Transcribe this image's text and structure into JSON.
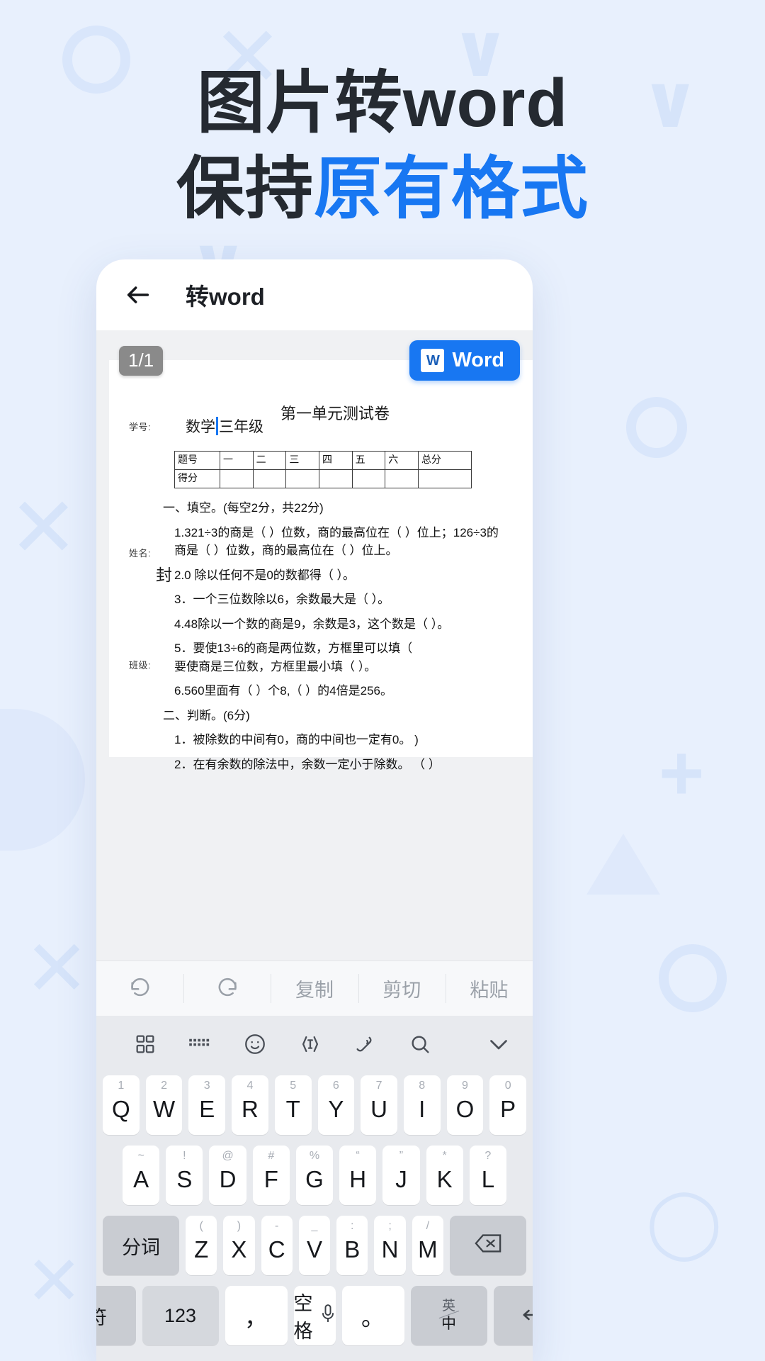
{
  "promo": {
    "headline_line1": "图片转word",
    "headline_line2_dark": "保持",
    "headline_line2_accent": "原有格式",
    "accent_color": "#1877f2",
    "background_color": "#e8f0fd"
  },
  "app": {
    "back_icon": "back-arrow-icon",
    "title": "转word",
    "page_badge": "1/1",
    "export_button": {
      "label": "Word",
      "icon": "word-file-icon",
      "color": "#1877f2"
    }
  },
  "document": {
    "title": "第一单元测试卷",
    "side_labels": [
      "学号:",
      "姓名:",
      "班级:"
    ],
    "seal_char": "封",
    "subject_before_caret": "数学",
    "subject_after_caret": "三年级",
    "score_table": {
      "rows": [
        [
          "题号",
          "一",
          "二",
          "三",
          "四",
          "五",
          "六",
          "总分"
        ],
        [
          "得分",
          "",
          "",
          "",
          "",
          "",
          "",
          ""
        ]
      ]
    },
    "sections": [
      {
        "heading": "一、填空。(每空2分，共22分)",
        "items": [
          "1.321÷3的商是（  ）位数，商的最高位在（  ）位上；126÷3的",
          "商是（  ）位数，商的最高位在（  ）位上。",
          "2.0 除以任何不是0的数都得（  ）。",
          "3．一个三位数除以6，余数最大是（  ）。",
          "4.48除以一个数的商是9，余数是3，这个数是（  ）。",
          "5．要使13÷6的商是两位数，方框里可以填（",
          "要使商是三位数，方框里最小填（  ）。",
          "6.560里面有（  ）个8,（  ）的4倍是256。"
        ]
      },
      {
        "heading": "二、判断。(6分)",
        "items": [
          "1．被除数的中间有0，商的中间也一定有0。   )",
          "2．在有余数的除法中，余数一定小于除数。 （ ）"
        ],
        "trailing": ")"
      }
    ]
  },
  "keyboard": {
    "toolbar": [
      {
        "name": "undo",
        "label": "",
        "icon": "undo-icon"
      },
      {
        "name": "redo",
        "label": "",
        "icon": "redo-icon"
      },
      {
        "name": "copy",
        "label": "复制",
        "icon": ""
      },
      {
        "name": "cut",
        "label": "剪切",
        "icon": ""
      },
      {
        "name": "paste",
        "label": "粘贴",
        "icon": ""
      }
    ],
    "iconbar": [
      "grid-icon",
      "keyboard-icon",
      "emoji-icon",
      "text-edit-icon",
      "voice-wave-icon",
      "search-icon",
      "chevron-down-icon"
    ],
    "rows": [
      [
        {
          "num": "1",
          "key": "Q"
        },
        {
          "num": "2",
          "key": "W"
        },
        {
          "num": "3",
          "key": "E"
        },
        {
          "num": "4",
          "key": "R"
        },
        {
          "num": "5",
          "key": "T"
        },
        {
          "num": "6",
          "key": "Y"
        },
        {
          "num": "7",
          "key": "U"
        },
        {
          "num": "8",
          "key": "I"
        },
        {
          "num": "9",
          "key": "O"
        },
        {
          "num": "0",
          "key": "P"
        }
      ],
      [
        {
          "num": "~",
          "key": "A"
        },
        {
          "num": "!",
          "key": "S"
        },
        {
          "num": "@",
          "key": "D"
        },
        {
          "num": "#",
          "key": "F"
        },
        {
          "num": "%",
          "key": "G"
        },
        {
          "num": "“",
          "key": "H"
        },
        {
          "num": "”",
          "key": "J"
        },
        {
          "num": "*",
          "key": "K"
        },
        {
          "num": "?",
          "key": "L"
        }
      ],
      [
        {
          "num": "",
          "key": "分词",
          "fn": true
        },
        {
          "num": "(",
          "key": "Z"
        },
        {
          "num": ")",
          "key": "X"
        },
        {
          "num": "-",
          "key": "C"
        },
        {
          "num": "_",
          "key": "V"
        },
        {
          "num": ":",
          "key": "B"
        },
        {
          "num": ";",
          "key": "N"
        },
        {
          "num": "/",
          "key": "M"
        },
        {
          "num": "",
          "key": "backspace-icon",
          "fn": true
        }
      ]
    ],
    "bottom_row": {
      "symbol": "符",
      "numeric": "123",
      "comma": "，",
      "space": "空格",
      "space_icon": "microphone-icon",
      "period": "。",
      "lang_en": "英",
      "lang_cn": "中",
      "enter": "enter-icon"
    }
  }
}
